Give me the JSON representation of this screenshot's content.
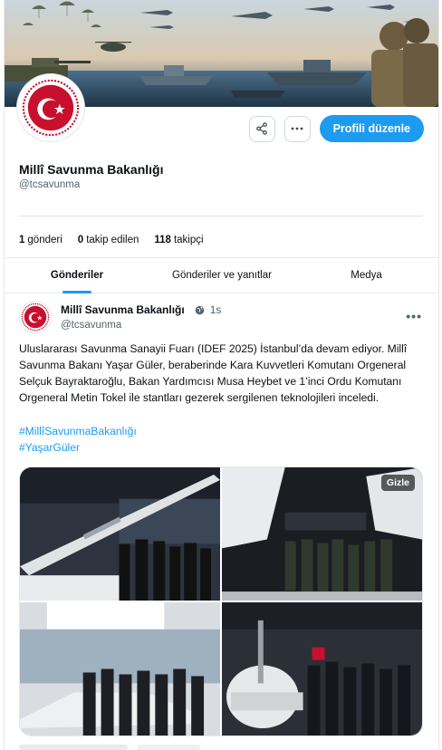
{
  "profile": {
    "name": "Millî Savunma Bakanlığı",
    "handle": "@tcsavunma",
    "edit_label": "Profili düzenle",
    "share_icon": "share-icon",
    "more_icon": "ellipsis-icon"
  },
  "stats": [
    {
      "value": "1",
      "label": "gönderi"
    },
    {
      "value": "0",
      "label": "takip edilen"
    },
    {
      "value": "118",
      "label": "takipçi"
    }
  ],
  "tabs": [
    {
      "label": "Gönderiler",
      "active": true
    },
    {
      "label": "Gönderiler ve yanıtlar",
      "active": false
    },
    {
      "label": "Medya",
      "active": false
    }
  ],
  "post": {
    "author": "Millî Savunma Bakanlığı",
    "handle": "@tcsavunma",
    "time": "1s",
    "text": "Uluslararası Savunma Sanayii Fuarı (IDEF 2025) İstanbul’da devam ediyor. Millî Savunma Bakanı Yaşar Güler, beraberinde Kara Kuvvetleri Komutanı Orgeneral Selçuk Bayraktaroğlu, Bakan Yardımcısı Musa Heybet ve 1’inci Ordu Komutanı Orgeneral Metin Tokel ile stantları gezerek sergilenen teknolojileri inceledi.",
    "hashtags": [
      "#MillîSavunmaBakanlığı",
      "#YaşarGüler"
    ],
    "media_badge": "Gizle",
    "more_label": "•••"
  },
  "colors": {
    "accent": "#1d9bf0",
    "logo_red": "#c8102e"
  }
}
